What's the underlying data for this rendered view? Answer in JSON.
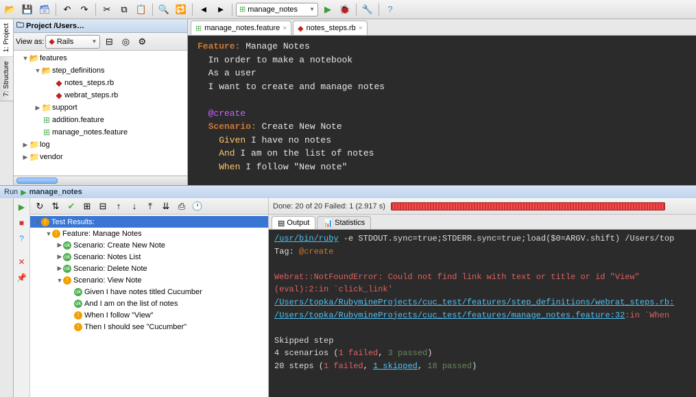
{
  "toolbar": {
    "run_config": "manage_notes"
  },
  "sidetabs": {
    "project": "1: Project",
    "structure": "7: Structure"
  },
  "project": {
    "title": "Project /Users…",
    "view_as_label": "View as:",
    "view_as_value": "Rails",
    "tree": {
      "features": "features",
      "step_definitions": "step_definitions",
      "notes_steps": "notes_steps.rb",
      "webrat_steps": "webrat_steps.rb",
      "support": "support",
      "addition": "addition.feature",
      "manage_notes": "manage_notes.feature",
      "log": "log",
      "vendor": "vendor"
    }
  },
  "editor": {
    "tab1": "manage_notes.feature",
    "tab2": "notes_steps.rb",
    "lines": {
      "l1a": "Feature:",
      "l1b": " Manage Notes",
      "l2": "  In order to make a notebook",
      "l3": "  As a user",
      "l4": "  I want to create and manage notes",
      "l5": "  @create",
      "l6a": "  Scenario:",
      "l6b": " Create New Note",
      "l7a": "    Given",
      "l7b": " I have no notes",
      "l8a": "    And",
      "l8b": " I am on the list of notes",
      "l9a": "    When",
      "l9b": " I follow \"New note\""
    }
  },
  "run": {
    "header_label": "Run",
    "header_config": "manage_notes",
    "done": "Done: 20 of 20  Failed: 1  (2.917 s)",
    "results_root": "Test Results:",
    "feature": "Feature: Manage Notes",
    "s1": "Scenario: Create New Note",
    "s2": "Scenario: Notes List",
    "s3": "Scenario: Delete Note",
    "s4": "Scenario: View Note",
    "step1": "Given I have notes titled Cucumber",
    "step2": "And I am on the list of notes",
    "step3": "When I follow \"View\"",
    "step4": "Then I should see \"Cucumber\"",
    "output_tab": "Output",
    "stats_tab": "Statistics"
  },
  "console": {
    "l1a": "/usr/bin/ruby",
    "l1b": " -e STDOUT.sync=true;STDERR.sync=true;load($0=ARGV.shift) /Users/top",
    "l2a": "Tag: ",
    "l2b": "@create",
    "l3": "Webrat::NotFoundError: Could not find link with text or title or id \"View\"",
    "l4": "(eval):2:in `click_link'",
    "l5": "/Users/topka/RubymineProjects/cuc_test/features/step_definitions/webrat_steps.rb:",
    "l6a": "/Users/topka/RubymineProjects/cuc_test/features/manage_notes.feature:32",
    "l6b": ":in `When ",
    "l7": "Skipped step",
    "l8a": "4 scenarios (",
    "l8b": "1 failed",
    "l8c": ", ",
    "l8d": "3 passed",
    "l8e": ")",
    "l9a": "20 steps (",
    "l9b": "1 failed",
    "l9c": ", ",
    "l9d": "1 skipped",
    "l9e": ", ",
    "l9f": "18 passed",
    "l9g": ")"
  }
}
